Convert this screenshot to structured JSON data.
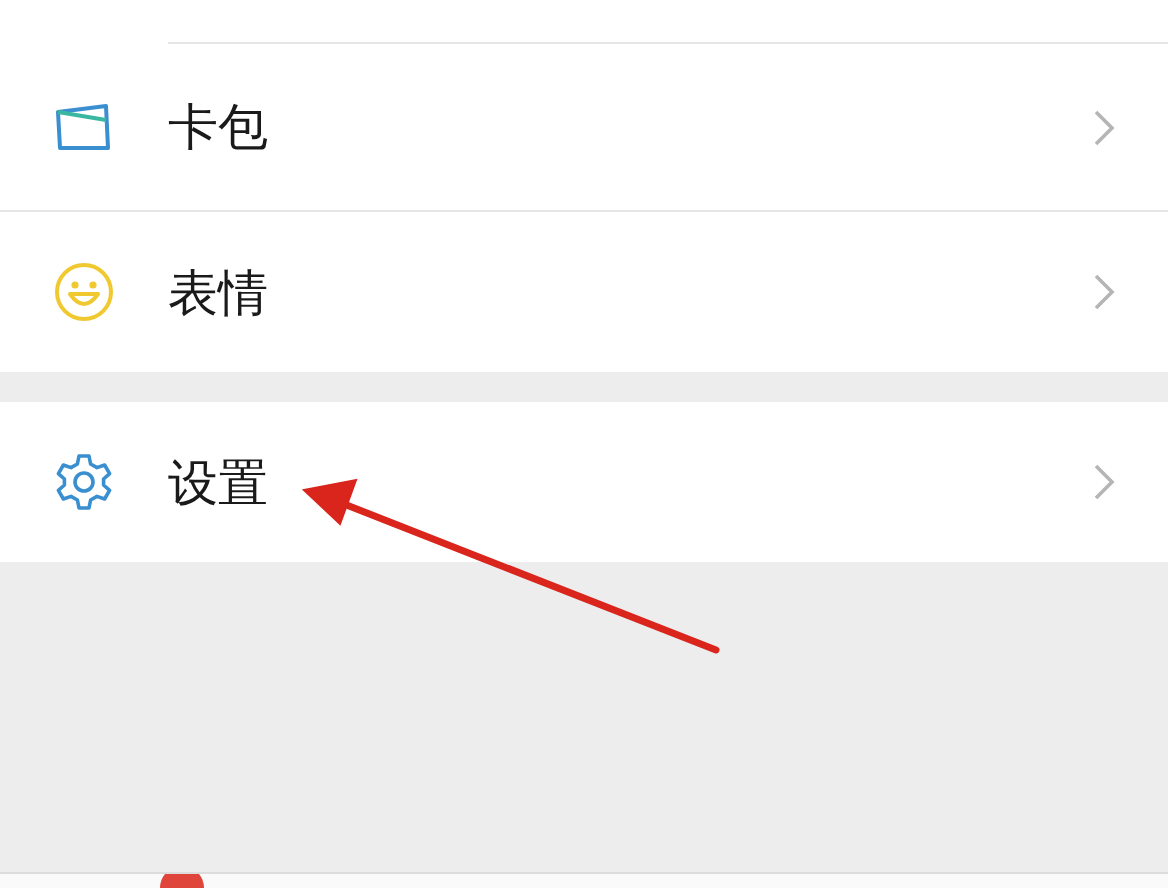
{
  "groups": [
    {
      "items": [
        {
          "label": "卡包",
          "kind": "wallet"
        },
        {
          "label": "表情",
          "kind": "emoji"
        }
      ]
    },
    {
      "items": [
        {
          "label": "设置",
          "kind": "settings"
        }
      ]
    }
  ]
}
